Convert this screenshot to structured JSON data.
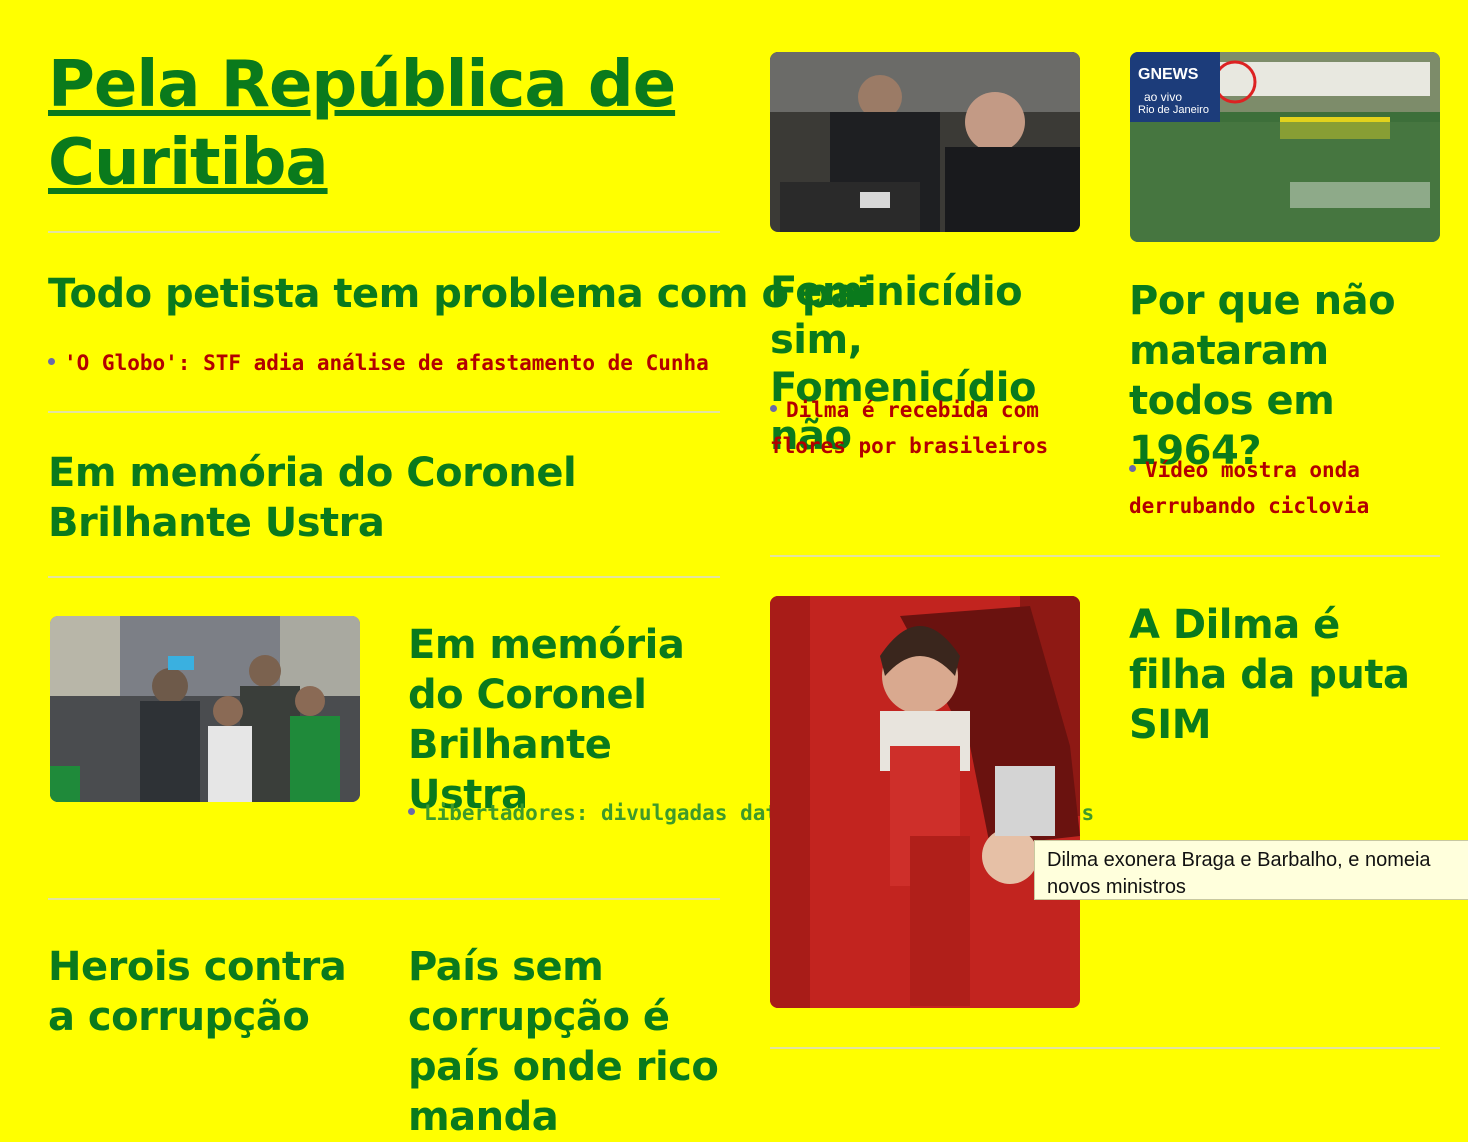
{
  "site": {
    "title": "Pela República de Curitiba"
  },
  "left": {
    "story1": {
      "headline": "Todo petista tem problema com o pai",
      "link": "'O Globo': STF adia análise de afastamento de Cunha"
    },
    "story2": {
      "headline": "Em memória do Coronel Brilhante Ustra"
    },
    "story3": {
      "headline": "Em memória do Coronel Brilhante Ustra",
      "link": "Libertadores: divulgadas datas e horários das oitavas"
    },
    "story4": {
      "headline": "Herois contra a corrupção"
    },
    "story5": {
      "headline": "País sem corrupção é país onde rico manda"
    }
  },
  "right": {
    "card1": {
      "headline": "Feminicídio sim, Fomenicídio não",
      "link": "Dilma é recebida com flores por brasileiros"
    },
    "card2": {
      "headline": "Por que não mataram todos em 1964?",
      "link": "Vídeo mostra onda derrubando ciclovia",
      "image_text": {
        "brand": "GNEWS",
        "live": "ao vivo",
        "place": "Rio de Janeiro"
      }
    },
    "card3": {
      "headline": "A Dilma é filha da puta SIM"
    }
  },
  "tooltip": {
    "text": "Dilma exonera Braga e Barbalho, e nomeia novos ministros"
  },
  "colors": {
    "background": "#ffff00",
    "headline": "#0a7a1c",
    "link": "#b30000",
    "link_alt": "#3e9a2a"
  }
}
